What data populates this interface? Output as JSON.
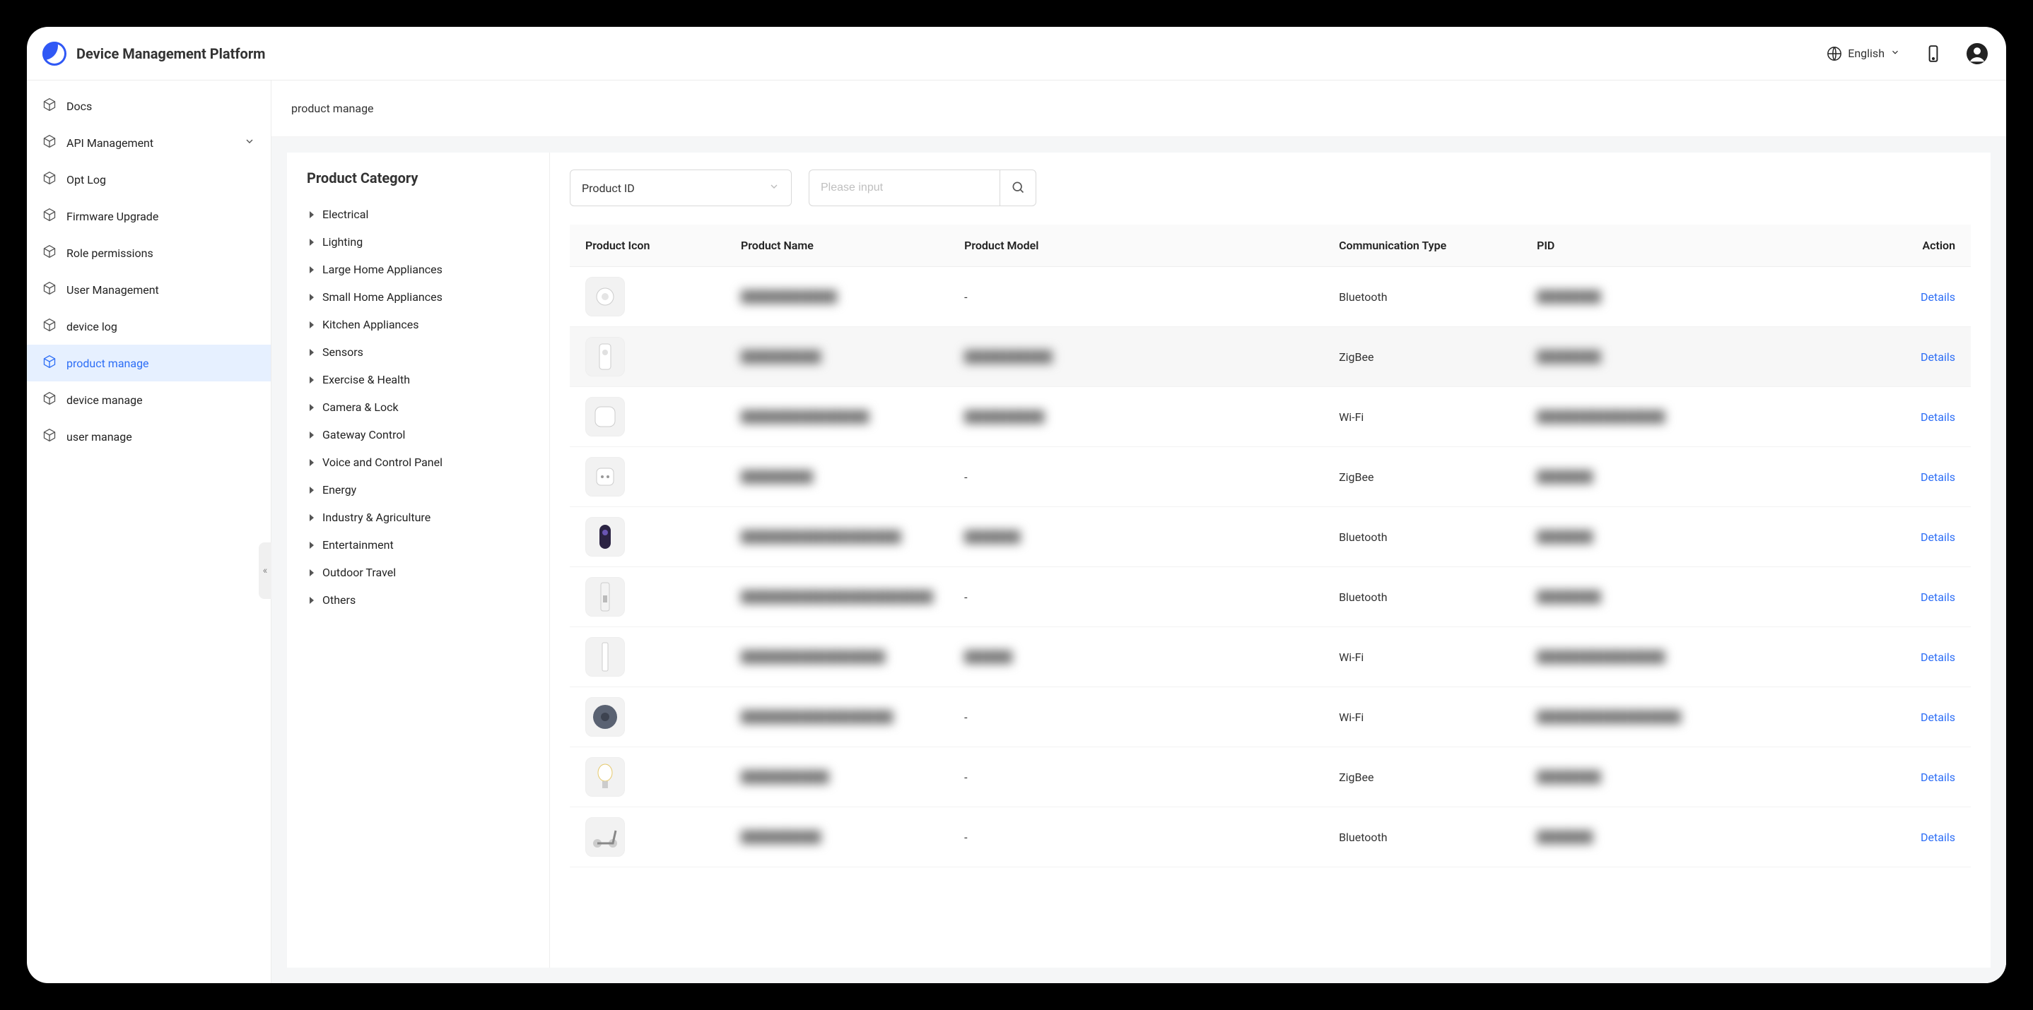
{
  "header": {
    "title": "Device Management Platform",
    "language_label": "English"
  },
  "sidebar": {
    "items": [
      {
        "label": "Docs",
        "expandable": false
      },
      {
        "label": "API Management",
        "expandable": true
      },
      {
        "label": "Opt Log",
        "expandable": false
      },
      {
        "label": "Firmware Upgrade",
        "expandable": false
      },
      {
        "label": "Role permissions",
        "expandable": false
      },
      {
        "label": "User Management",
        "expandable": false
      },
      {
        "label": "device log",
        "expandable": false
      },
      {
        "label": "product manage",
        "expandable": false,
        "active": true
      },
      {
        "label": "device manage",
        "expandable": false
      },
      {
        "label": "user manage",
        "expandable": false
      }
    ]
  },
  "breadcrumb": "product manage",
  "category": {
    "title": "Product Category",
    "items": [
      "Electrical",
      "Lighting",
      "Large Home Appliances",
      "Small Home Appliances",
      "Kitchen Appliances",
      "Sensors",
      "Exercise & Health",
      "Camera & Lock",
      "Gateway Control",
      "Voice and Control Panel",
      "Energy",
      "Industry & Agriculture",
      "Entertainment",
      "Outdoor Travel",
      "Others"
    ]
  },
  "filters": {
    "select_value": "Product ID",
    "search_placeholder": "Please input"
  },
  "table": {
    "columns": {
      "icon": "Product Icon",
      "name": "Product Name",
      "model": "Product Model",
      "comm": "Communication Type",
      "pid": "PID",
      "action": "Action"
    },
    "action_label": "Details",
    "rows": [
      {
        "icon_hint": "sensor-round",
        "name": "████████████",
        "model": "-",
        "comm": "Bluetooth",
        "pid": "████████"
      },
      {
        "icon_hint": "door-sensor",
        "name": "██████████",
        "model": "███████████",
        "comm": "ZigBee",
        "pid": "████████",
        "hovered": true
      },
      {
        "icon_hint": "hub-square",
        "name": "████████████████",
        "model": "██████████",
        "comm": "Wi-Fi",
        "pid": "████████████████"
      },
      {
        "icon_hint": "socket",
        "name": "█████████",
        "model": "-",
        "comm": "ZigBee",
        "pid": "███████"
      },
      {
        "icon_hint": "speaker",
        "name": "████████████████████",
        "model": "███████",
        "comm": "Bluetooth",
        "pid": "███████"
      },
      {
        "icon_hint": "door-lock",
        "name": "████████████████████████",
        "model": "-",
        "comm": "Bluetooth",
        "pid": "████████"
      },
      {
        "icon_hint": "strip",
        "name": "██████████████████",
        "model": "██████",
        "comm": "Wi-Fi",
        "pid": "████████████████"
      },
      {
        "icon_hint": "robot-vacuum",
        "name": "███████████████████",
        "model": "-",
        "comm": "Wi-Fi",
        "pid": "██████████████████"
      },
      {
        "icon_hint": "bulb",
        "name": "███████████",
        "model": "-",
        "comm": "ZigBee",
        "pid": "████████"
      },
      {
        "icon_hint": "scooter",
        "name": "██████████",
        "model": "-",
        "comm": "Bluetooth",
        "pid": "███████"
      }
    ]
  }
}
